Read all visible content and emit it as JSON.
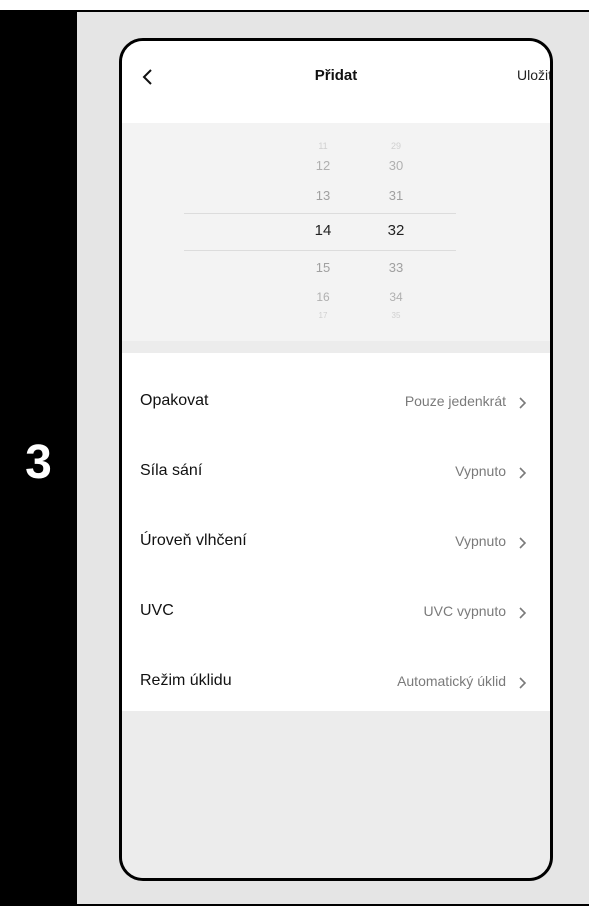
{
  "step": {
    "number": "3"
  },
  "header": {
    "title": "Přidat",
    "save_label": "Uložit"
  },
  "picker": {
    "hours": [
      "11",
      "12",
      "13",
      "14",
      "15",
      "16",
      "17"
    ],
    "minutes": [
      "29",
      "30",
      "31",
      "32",
      "33",
      "34",
      "35"
    ],
    "selected_hour": "14",
    "selected_minute": "32"
  },
  "settings": [
    {
      "label": "Opakovat",
      "value": "Pouze jedenkrát"
    },
    {
      "label": "Síla sání",
      "value": "Vypnuto"
    },
    {
      "label": "Úroveň vlhčení",
      "value": "Vypnuto"
    },
    {
      "label": "UVC",
      "value": "UVC vypnuto"
    },
    {
      "label": "Režim úklidu",
      "value": "Automatický úklid"
    }
  ],
  "colors": {
    "frame": "#000000",
    "panel": "#e5e5e5",
    "value_text": "#7a7a7a"
  },
  "icons": {
    "back": "chevron-left-icon",
    "row": "chevron-right-icon"
  }
}
